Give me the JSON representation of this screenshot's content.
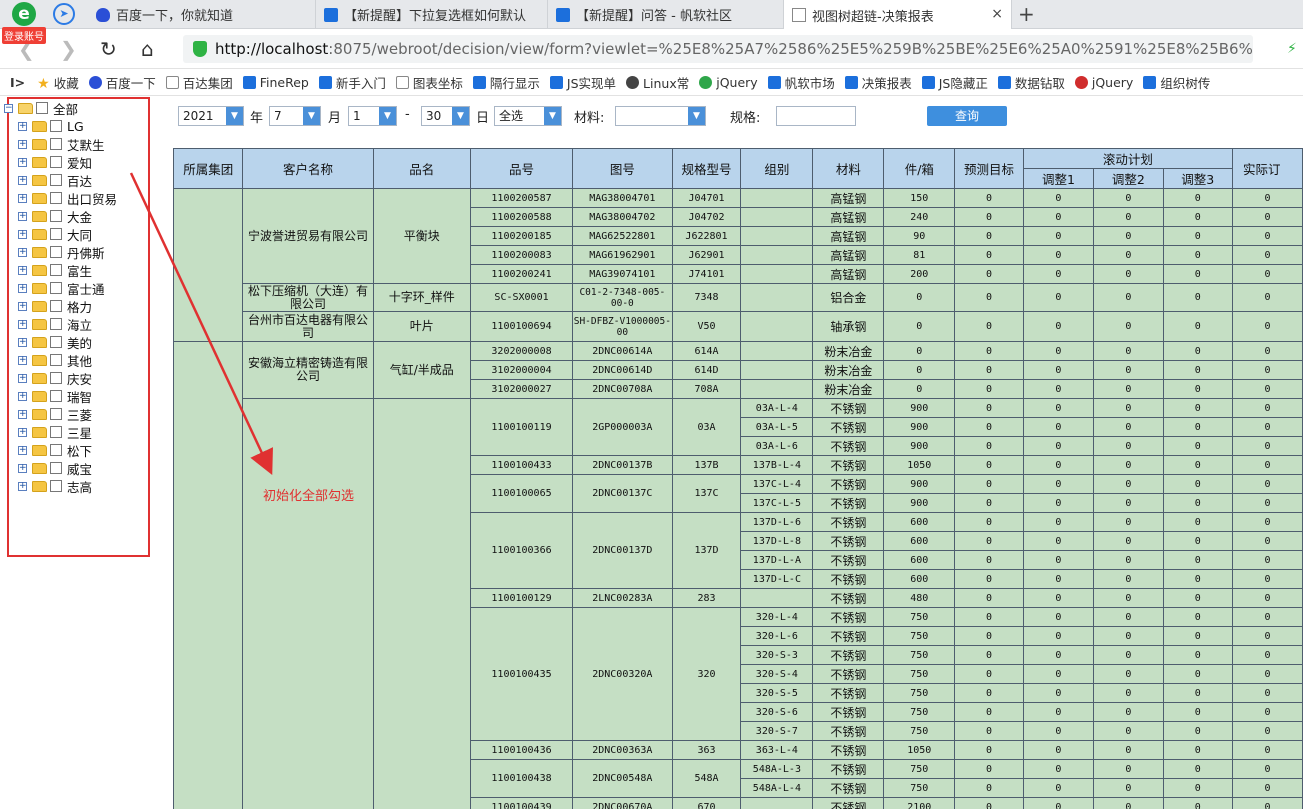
{
  "browser": {
    "login_badge": "登录账号",
    "tabs": [
      {
        "title": "百度一下，你就知道",
        "icon": "baidu-paw-icon",
        "active": false
      },
      {
        "title": "【新提醒】下拉复选框如何默认",
        "icon": "fanruan-icon",
        "active": false
      },
      {
        "title": "【新提醒】问答 - 帆软社区",
        "icon": "fanruan-icon",
        "active": false
      },
      {
        "title": "视图树超链-决策报表",
        "icon": "document-icon",
        "active": true
      }
    ],
    "close_glyph": "×",
    "newtab_glyph": "+",
    "url_host": "http://localhost",
    "url_rest": ":8075/webroot/decision/view/form?viewlet=%25E8%25A7%2586%25E5%259B%25BE%25E6%25A0%2591%25E8%25B6%2585%25E9%2593%25BE",
    "bookmarks": [
      {
        "label": "收藏",
        "icon": "star-icon"
      },
      {
        "label": "百度一下",
        "icon": "baidu-paw-icon"
      },
      {
        "label": "百达集团",
        "icon": "document-icon"
      },
      {
        "label": "FineRep",
        "icon": "fanruan-icon"
      },
      {
        "label": "新手入门",
        "icon": "fanruan-icon"
      },
      {
        "label": "图表坐标",
        "icon": "document-icon"
      },
      {
        "label": "隔行显示",
        "icon": "fanruan-icon"
      },
      {
        "label": "JS实现单",
        "icon": "fanruan-icon"
      },
      {
        "label": "Linux常",
        "icon": "linux-icon"
      },
      {
        "label": "jQuery",
        "icon": "jquery-icon"
      },
      {
        "label": "帆软市场",
        "icon": "fanruan-icon"
      },
      {
        "label": "决策报表",
        "icon": "fanruan-icon"
      },
      {
        "label": "JS隐藏正",
        "icon": "fanruan-icon"
      },
      {
        "label": "数据钻取",
        "icon": "fanruan-icon"
      },
      {
        "label": "jQuery",
        "icon": "jquery-red-icon"
      },
      {
        "label": "组织树传",
        "icon": "fanruan-icon"
      }
    ]
  },
  "tree": {
    "root": "全部",
    "items": [
      "LG",
      "艾默生",
      "爱知",
      "百达",
      "出口贸易",
      "大金",
      "大同",
      "丹佛斯",
      "富生",
      "富士通",
      "格力",
      "海立",
      "美的",
      "其他",
      "庆安",
      "瑞智",
      "三菱",
      "三星",
      "松下",
      "威宝",
      "志高"
    ],
    "annotation": "初始化全部勾选"
  },
  "filters": {
    "year": "2021",
    "year_label": "年",
    "month": "7",
    "month_label": "月",
    "day_from": "1",
    "dash": "-",
    "day_to": "30",
    "day_label": "日",
    "select_all": "全选",
    "material_label": "材料:",
    "material_value": "",
    "spec_label": "规格:",
    "spec_value": "",
    "query_button": "查询"
  },
  "table": {
    "headers": {
      "group": "所属集团",
      "customer": "客户名称",
      "product": "品名",
      "part_no": "品号",
      "drawing_no": "图号",
      "model": "规格型号",
      "team": "组别",
      "material": "材料",
      "per_box": "件/箱",
      "forecast": "预测目标",
      "rolling": "滚动计划",
      "adj1": "调整1",
      "adj2": "调整2",
      "adj3": "调整3",
      "actual": "实际订"
    },
    "rows": [
      {
        "customer": "宁波誉进贸易有限公司",
        "product": "平衡块",
        "part": "1100200587",
        "drawing": "MAG38004701",
        "model": "J04701",
        "team": "",
        "material": "高锰钢",
        "per_box": "150"
      },
      {
        "part": "1100200588",
        "drawing": "MAG38004702",
        "model": "J04702",
        "team": "",
        "material": "高锰钢",
        "per_box": "240"
      },
      {
        "part": "1100200185",
        "drawing": "MAG62522801",
        "model": "J622801",
        "team": "",
        "material": "高锰钢",
        "per_box": "90"
      },
      {
        "part": "1100200083",
        "drawing": "MAG61962901",
        "model": "J62901",
        "team": "",
        "material": "高锰钢",
        "per_box": "81"
      },
      {
        "part": "1100200241",
        "drawing": "MAG39074101",
        "model": "J74101",
        "team": "",
        "material": "高锰钢",
        "per_box": "200"
      },
      {
        "customer": "松下压缩机（大连）有限公司",
        "product": "十字环_样件",
        "part": "SC-SX0001",
        "drawing": "C01-2-7348-005-00-0",
        "model": "7348",
        "team": "",
        "material": "铝合金",
        "per_box": "0"
      },
      {
        "customer": "台州市百达电器有限公司",
        "product": "叶片",
        "part": "1100100694",
        "drawing": "SH-DFBZ-V1000005-00",
        "model": "V50",
        "team": "",
        "material": "轴承钢",
        "per_box": "0"
      },
      {
        "customer": "安徽海立精密铸造有限公司",
        "product": "气缸/半成品",
        "part": "3202000008",
        "drawing": "2DNC00614A",
        "model": "614A",
        "team": "",
        "material": "粉末冶金",
        "per_box": "0"
      },
      {
        "part": "3102000004",
        "drawing": "2DNC00614D",
        "model": "614D",
        "team": "",
        "material": "粉末冶金",
        "per_box": "0"
      },
      {
        "part": "3102000027",
        "drawing": "2DNC00708A",
        "model": "708A",
        "team": "",
        "material": "粉末冶金",
        "per_box": "0"
      },
      {
        "part": "1100100119",
        "drawing": "2GP000003A",
        "model": "03A",
        "team": "03A-L-4",
        "material": "不锈钢",
        "per_box": "900"
      },
      {
        "team": "03A-L-5",
        "material": "不锈钢",
        "per_box": "900"
      },
      {
        "team": "03A-L-6",
        "material": "不锈钢",
        "per_box": "900"
      },
      {
        "part": "1100100433",
        "drawing": "2DNC00137B",
        "model": "137B",
        "team": "137B-L-4",
        "material": "不锈钢",
        "per_box": "1050"
      },
      {
        "part": "1100100065",
        "drawing": "2DNC00137C",
        "model": "137C",
        "team": "137C-L-4",
        "material": "不锈钢",
        "per_box": "900"
      },
      {
        "team": "137C-L-5",
        "material": "不锈钢",
        "per_box": "900"
      },
      {
        "part": "1100100366",
        "drawing": "2DNC00137D",
        "model": "137D",
        "team": "137D-L-6",
        "material": "不锈钢",
        "per_box": "600"
      },
      {
        "team": "137D-L-8",
        "material": "不锈钢",
        "per_box": "600"
      },
      {
        "team": "137D-L-A",
        "material": "不锈钢",
        "per_box": "600"
      },
      {
        "team": "137D-L-C",
        "material": "不锈钢",
        "per_box": "600"
      },
      {
        "part": "1100100129",
        "drawing": "2LNC00283A",
        "model": "283",
        "team": "",
        "material": "不锈钢",
        "per_box": "480"
      },
      {
        "part": "1100100435",
        "drawing": "2DNC00320A",
        "model": "320",
        "team": "320-L-4",
        "material": "不锈钢",
        "per_box": "750"
      },
      {
        "team": "320-L-6",
        "material": "不锈钢",
        "per_box": "750"
      },
      {
        "team": "320-S-3",
        "material": "不锈钢",
        "per_box": "750"
      },
      {
        "team": "320-S-4",
        "material": "不锈钢",
        "per_box": "750"
      },
      {
        "team": "320-S-5",
        "material": "不锈钢",
        "per_box": "750"
      },
      {
        "team": "320-S-6",
        "material": "不锈钢",
        "per_box": "750"
      },
      {
        "team": "320-S-7",
        "material": "不锈钢",
        "per_box": "750"
      },
      {
        "part": "1100100436",
        "drawing": "2DNC00363A",
        "model": "363",
        "team": "363-L-4",
        "material": "不锈钢",
        "per_box": "1050"
      },
      {
        "part": "1100100438",
        "drawing": "2DNC00548A",
        "model": "548A",
        "team": "548A-L-3",
        "material": "不锈钢",
        "per_box": "750"
      },
      {
        "team": "548A-L-4",
        "material": "不锈钢",
        "per_box": "750"
      },
      {
        "part": "1100100439",
        "drawing": "2DNC00670A",
        "model": "670",
        "team": "",
        "material": "不锈钢",
        "per_box": "2100"
      }
    ],
    "zero": "0"
  },
  "colors": {
    "accent": "#3e8fde",
    "annotation": "#e03131",
    "header_bg": "#b9d4ec",
    "cell_bg": "#c5dfc4"
  }
}
